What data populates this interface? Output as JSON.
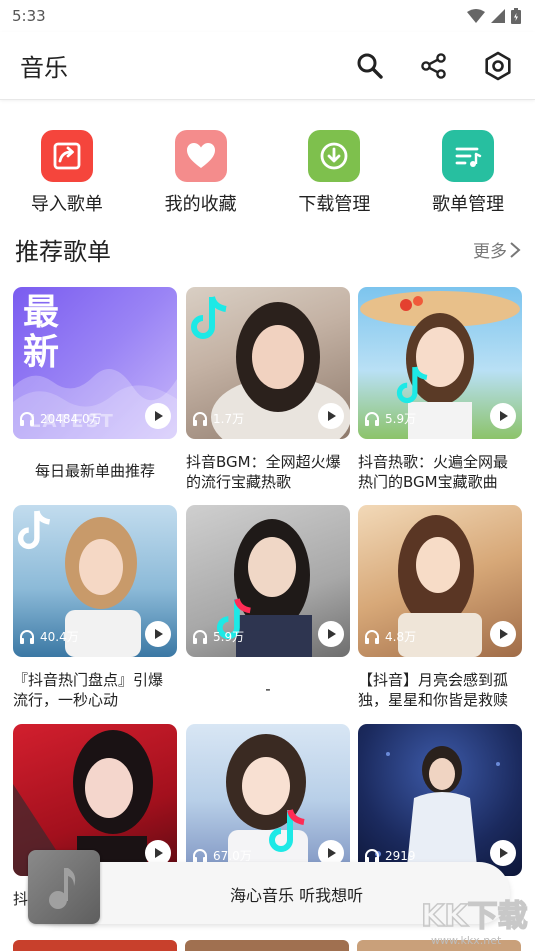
{
  "status": {
    "time": "5:33"
  },
  "app": {
    "title": "音乐"
  },
  "icons": {
    "search": "search-icon",
    "share": "share-icon",
    "settings": "settings-icon"
  },
  "quick": [
    {
      "label": "导入歌单",
      "icon": "import-icon",
      "color": "#f5453c"
    },
    {
      "label": "我的收藏",
      "icon": "heart-icon",
      "color": "#f48c8c"
    },
    {
      "label": "下载管理",
      "icon": "download-icon",
      "color": "#7ec04d"
    },
    {
      "label": "歌单管理",
      "icon": "playlist-icon",
      "color": "#27bfa0"
    }
  ],
  "section": {
    "title": "推荐歌单",
    "more": "更多"
  },
  "playlists": [
    {
      "count": "20484.0万",
      "title": "每日最新单曲推荐",
      "cover_text": [
        "最",
        "新"
      ],
      "cover_sub": "LATEST"
    },
    {
      "count": "1.7万",
      "title": "抖音BGM：全网超火爆的流行宝藏热歌"
    },
    {
      "count": "5.9万",
      "title": "抖音热歌：火遍全网最热门的BGM宝藏歌曲"
    },
    {
      "count": "40.4万",
      "title": "『抖音热门盘点』引爆流行，一秒心动"
    },
    {
      "count": "5.9万",
      "title": "-"
    },
    {
      "count": "4.8万",
      "title": "【抖音】月亮会感到孤独，星星和你皆是救赎"
    },
    {
      "count": "",
      "title": "抖"
    },
    {
      "count": "67.0万",
      "title": ""
    },
    {
      "count": "2919",
      "title": ""
    }
  ],
  "player": {
    "text": "海心音乐 听我想听"
  },
  "watermark": {
    "text": "KK下载",
    "url": "www.kkx.net"
  }
}
